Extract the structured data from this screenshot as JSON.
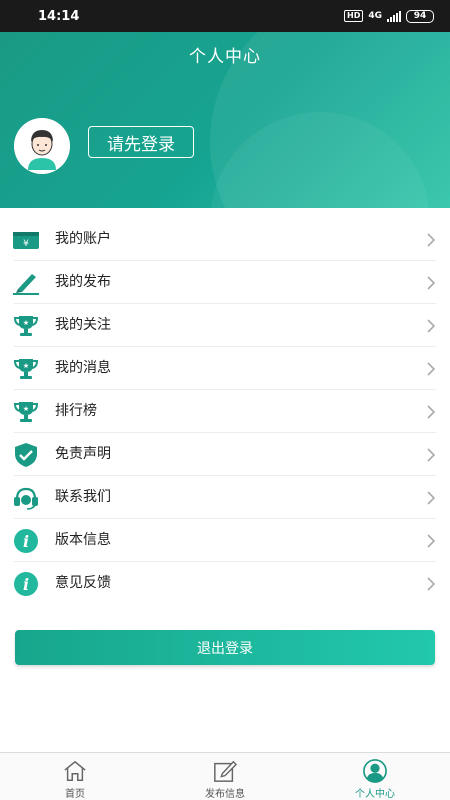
{
  "status_bar": {
    "time": "14:14",
    "network": "4G",
    "hd": "HD",
    "battery": "94"
  },
  "header": {
    "title": "个人中心",
    "login_label": "请先登录"
  },
  "menu": {
    "items": [
      {
        "label": "我的账户",
        "icon": "wallet-icon"
      },
      {
        "label": "我的发布",
        "icon": "pen-edit-icon"
      },
      {
        "label": "我的关注",
        "icon": "trophy-icon"
      },
      {
        "label": "我的消息",
        "icon": "trophy-icon"
      },
      {
        "label": "排行榜",
        "icon": "trophy-icon"
      },
      {
        "label": "免责声明",
        "icon": "shield-check-icon"
      },
      {
        "label": "联系我们",
        "icon": "headset-icon"
      },
      {
        "label": "版本信息",
        "icon": "info-icon"
      },
      {
        "label": "意见反馈",
        "icon": "info-icon"
      }
    ]
  },
  "logout_label": "退出登录",
  "tabs": [
    {
      "label": "首页",
      "icon": "home-icon",
      "active": false
    },
    {
      "label": "发布信息",
      "icon": "edit-icon",
      "active": false
    },
    {
      "label": "个人中心",
      "icon": "user-icon",
      "active": true
    }
  ],
  "colors": {
    "accent": "#1a9a85",
    "accent_light": "#22c8ac",
    "text": "#222222"
  }
}
